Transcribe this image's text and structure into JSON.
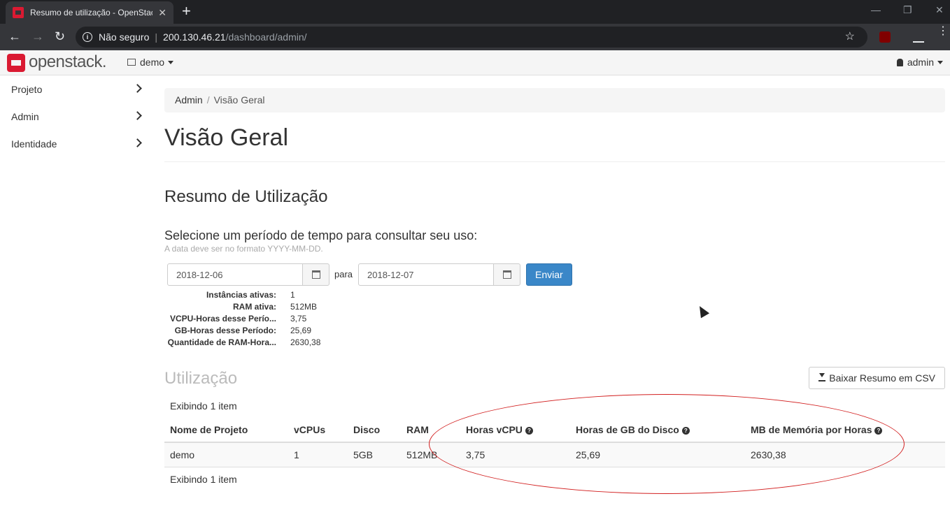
{
  "browser": {
    "tab_title": "Resumo de utilização - OpenStack",
    "tab_close": "✕",
    "new_tab": "+",
    "security_label": "Não seguro",
    "url_host": "200.130.46.21",
    "url_path": "/dashboard/admin/"
  },
  "header": {
    "logo_text": "openstack.",
    "project": "demo",
    "user": "admin"
  },
  "sidebar": {
    "items": [
      {
        "label": "Projeto"
      },
      {
        "label": "Admin"
      },
      {
        "label": "Identidade"
      }
    ]
  },
  "breadcrumb": {
    "root": "Admin",
    "separator": "/",
    "current": "Visão Geral"
  },
  "page": {
    "title": "Visão Geral",
    "section_title": "Resumo de Utilização",
    "period_label": "Selecione um período de tempo para consultar seu uso:",
    "date_help": "A data deve ser no formato YYYY-MM-DD.",
    "start_date": "2018-12-06",
    "between_label": "para",
    "end_date": "2018-12-07",
    "submit_label": "Enviar"
  },
  "summary": [
    {
      "key": "Instâncias ativas:",
      "value": "1"
    },
    {
      "key": "RAM ativa:",
      "value": "512MB"
    },
    {
      "key": "VCPU-Horas desse Perío...",
      "value": "3,75"
    },
    {
      "key": "GB-Horas desse Período:",
      "value": "25,69"
    },
    {
      "key": "Quantidade de RAM-Hora...",
      "value": "2630,38"
    }
  ],
  "usage": {
    "title": "Utilização",
    "csv_button": "Baixar Resumo em CSV",
    "count_top": "Exibindo 1 item",
    "count_bottom": "Exibindo 1 item",
    "columns": [
      "Nome de Projeto",
      "vCPUs",
      "Disco",
      "RAM",
      "Horas vCPU",
      "Horas de GB do Disco",
      "MB de Memória por Horas"
    ],
    "rows": [
      [
        "demo",
        "1",
        "5GB",
        "512MB",
        "3,75",
        "25,69",
        "2630,38"
      ]
    ]
  },
  "colors": {
    "brand": "#da1a32",
    "primary_button": "#3a87c8",
    "annotation": "#d21f1f"
  }
}
